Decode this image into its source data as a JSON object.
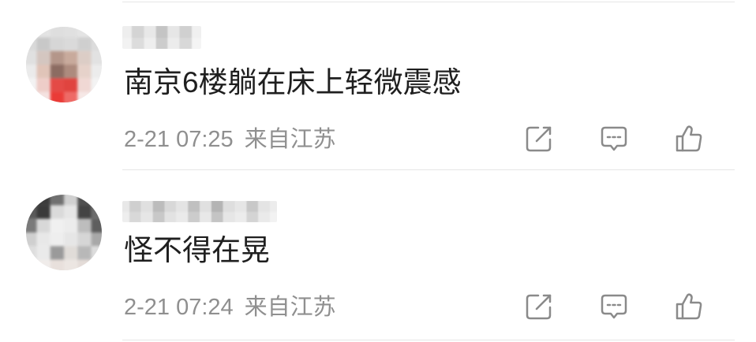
{
  "comments": [
    {
      "text": "南京6楼躺在床上轻微震感",
      "time": "2-21 07:25",
      "location": "来自江苏"
    },
    {
      "text": "怪不得在晃",
      "time": "2-21 07:24",
      "location": "来自江苏"
    }
  ],
  "icons": {
    "forward": "forward-icon",
    "comment": "comment-icon",
    "like": "like-icon"
  },
  "colors": {
    "content_text": "#1f1f1f",
    "meta_text": "#8f8f8f",
    "icon": "#8a8a8a",
    "divider": "#e6e6e6"
  }
}
